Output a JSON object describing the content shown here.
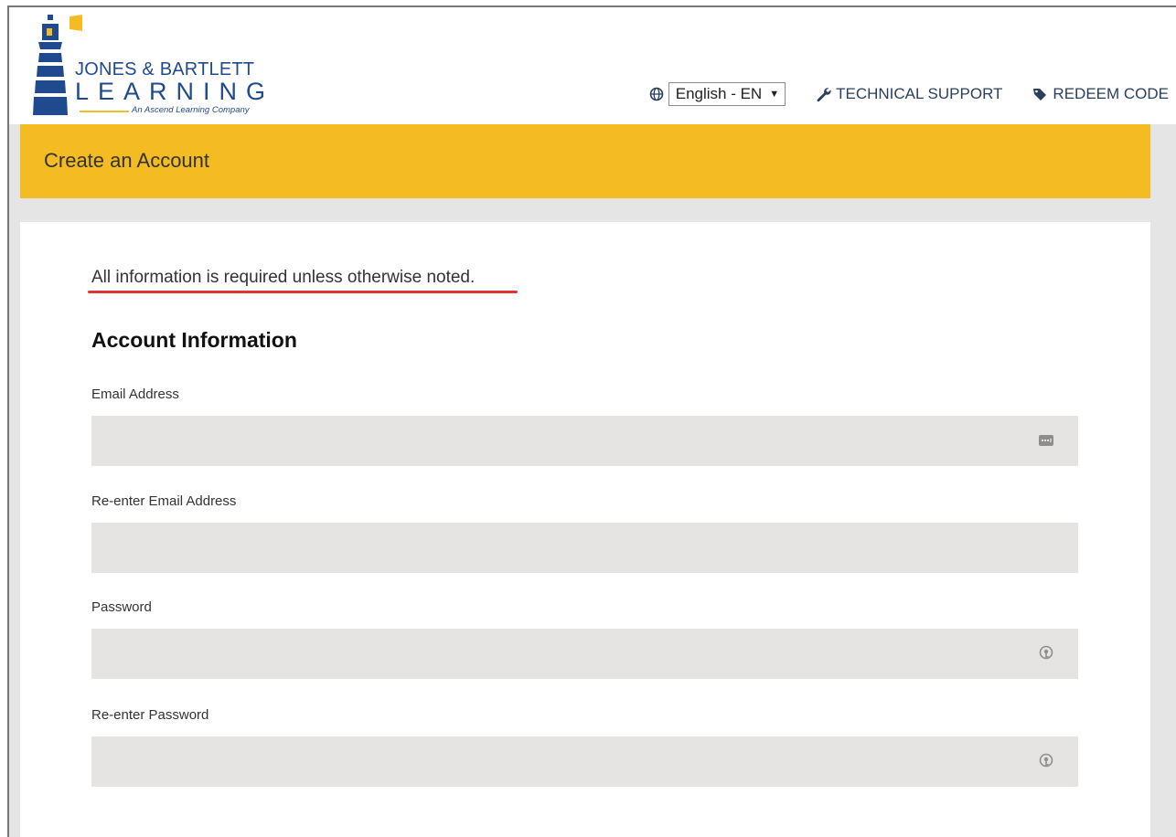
{
  "brand": {
    "line1": "JONES & BARTLETT",
    "line2": "LEARNING",
    "tagline": "An Ascend Learning Company"
  },
  "nav": {
    "language": "English - EN",
    "technical_support": "TECHNICAL SUPPORT",
    "redeem_code": "REDEEM CODE"
  },
  "page": {
    "title": "Create an Account",
    "required_note": "All information is required unless otherwise noted.",
    "section_title": "Account Information"
  },
  "fields": [
    {
      "label": "Email Address",
      "value": "",
      "icon": "autofill-dots-icon"
    },
    {
      "label": "Re-enter Email Address",
      "value": "",
      "icon": ""
    },
    {
      "label": "Password",
      "value": "",
      "icon": "password-key-icon"
    },
    {
      "label": "Re-enter Password",
      "value": "",
      "icon": "password-key-icon"
    }
  ],
  "colors": {
    "banner": "#f4bc22",
    "brand_blue": "#1f4b8e",
    "underline": "#e03434",
    "input_bg": "#e5e4e2"
  }
}
